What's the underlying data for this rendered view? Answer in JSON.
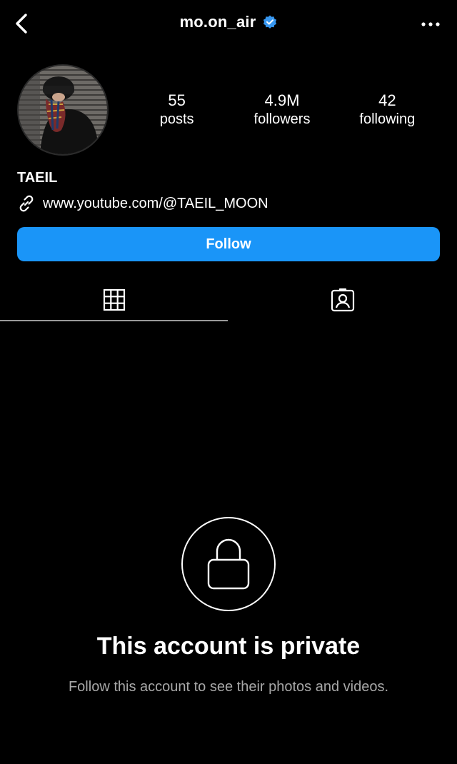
{
  "header": {
    "username": "mo.on_air",
    "verified_color": "#3797f0",
    "back_icon": "chevron-left-icon",
    "more_icon": "ellipsis-icon"
  },
  "profile": {
    "stats": [
      {
        "value": "55",
        "label": "posts"
      },
      {
        "value": "4.9M",
        "label": "followers"
      },
      {
        "value": "42",
        "label": "following"
      }
    ],
    "display_name": "TAEIL",
    "link_icon": "link-icon",
    "link": "www.youtube.com/@TAEIL_MOON"
  },
  "follow_button": {
    "label": "Follow",
    "color": "#1a95f8"
  },
  "tabs": [
    {
      "icon": "grid-icon",
      "active": true
    },
    {
      "icon": "tagged-icon",
      "active": false
    }
  ],
  "private_notice": {
    "icon": "lock-icon",
    "title": "This account is private",
    "subtitle": "Follow this account to see their photos and videos."
  }
}
